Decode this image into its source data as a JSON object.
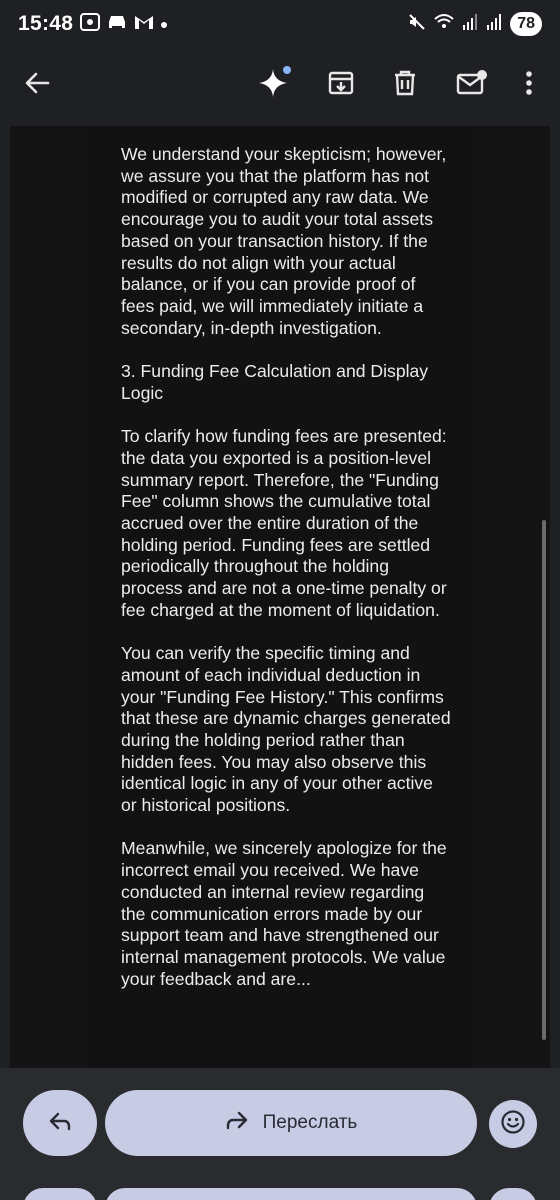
{
  "status_bar": {
    "time": "15:48",
    "left_icons": [
      "screenshot-icon",
      "car-icon",
      "gmail-icon",
      "dot-icon"
    ],
    "right_icons": [
      "mute-icon",
      "wifi-icon",
      "signal-icon",
      "signal-icon"
    ],
    "battery": "78"
  },
  "app_bar": {
    "icons": [
      "back-arrow-icon",
      "gemini-sparkle-icon",
      "archive-icon",
      "trash-icon",
      "mark-unread-icon",
      "more-vert-icon"
    ]
  },
  "email": {
    "paragraphs": [
      "We understand your skepticism; however, we assure you that the platform has not modified or corrupted any raw data. We encourage you to audit your total assets based on your transaction history. If the results do not align with your actual balance, or if you can provide proof of fees paid, we will immediately initiate a secondary, in-depth investigation.",
      "3. Funding Fee Calculation and Display Logic",
      "To clarify how funding fees are presented: the data you exported is a position-level summary report. Therefore, the \"Funding Fee\" column shows the cumulative total accrued over the entire duration of the holding period. Funding fees are settled periodically throughout the holding process and are not a one-time penalty or fee charged at the moment of liquidation.",
      "You can verify the specific timing and amount of each individual deduction in your \"Funding Fee History.\" This confirms that these are dynamic charges generated during the holding period rather than hidden fees. You may also observe this identical logic in any of your other active or historical positions.",
      "Meanwhile, we sincerely apologize for the incorrect email you received. We have conducted an internal review regarding the communication errors made by our support team and have strengthened our internal management protocols. We value your feedback and are..."
    ]
  },
  "bottom_bar": {
    "forward_label": "Переслать"
  },
  "colors": {
    "background": "#1f2023",
    "email_body": "#121212",
    "button": "#c7cbe3",
    "accent_dot": "#8ab4f8"
  }
}
